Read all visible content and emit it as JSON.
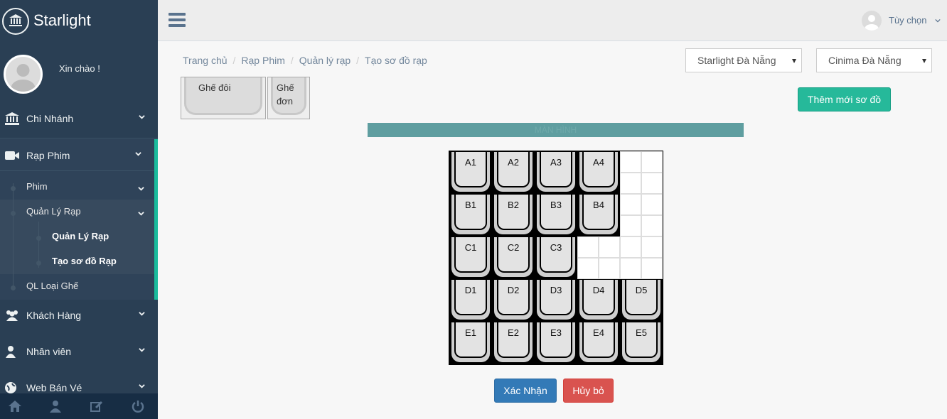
{
  "brand": {
    "name": "Starlight",
    "icon": "bank-icon"
  },
  "profile": {
    "greeting": "Xin chào !"
  },
  "sidebar": {
    "items": [
      {
        "label": "Chi Nhánh",
        "icon": "bank-icon"
      },
      {
        "label": "Rạp Phim",
        "icon": "video-camera-icon"
      },
      {
        "label": "Khách Hàng",
        "icon": "users-icon"
      },
      {
        "label": "Nhân viên",
        "icon": "user-icon"
      },
      {
        "label": "Web Bán Vé",
        "icon": "globe-icon"
      }
    ],
    "sub_items": {
      "phim": "Phim",
      "quan_ly_rap": "Quản Lý Rạp",
      "quan_ly_rap_child": "Quản Lý Rạp",
      "tao_so_do_rap": "Tạo sơ đồ Rạp",
      "ql_loai_ghe": "QL Loại Ghế"
    },
    "footer_icons": [
      "home-icon",
      "user-icon",
      "edit-icon",
      "power-icon"
    ]
  },
  "topbar": {
    "user_label": "Tùy chọn"
  },
  "breadcrumb": [
    "Trang chủ",
    "Rạp Phim",
    "Quản lý rạp",
    "Tạo sơ đồ rạp"
  ],
  "selects": {
    "branch": "Starlight Đà Nẵng",
    "cinema": "Cinima Đà Nẵng"
  },
  "palette": {
    "double_seat": "Ghế đôi",
    "single_seat_line1": "Ghế",
    "single_seat_line2": "đơn"
  },
  "buttons": {
    "add_new": "Thêm mới sơ đồ",
    "confirm": "Xác Nhận",
    "cancel": "Hủy bỏ"
  },
  "screen_label": "MÀN HÌNH",
  "seat_map": {
    "rows": [
      [
        "A1",
        "A2",
        "A3",
        "A4"
      ],
      [
        "B1",
        "B2",
        "B3",
        "B4"
      ],
      [
        "C1",
        "C2",
        "C3"
      ],
      [
        "D1",
        "D2",
        "D3",
        "D4",
        "D5"
      ],
      [
        "E1",
        "E2",
        "E3",
        "E4",
        "E5"
      ]
    ]
  }
}
